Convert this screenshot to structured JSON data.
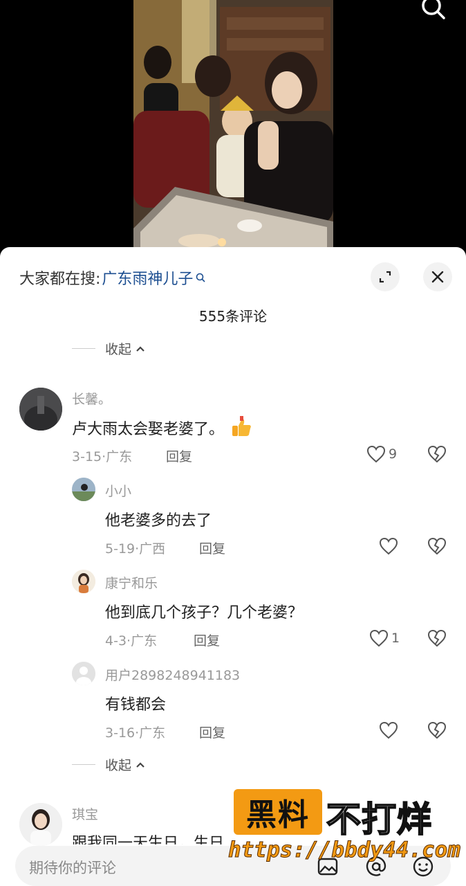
{
  "search": {
    "prefix": "大家都在搜:",
    "term": "广东雨神儿子"
  },
  "comments_count": "555条评论",
  "collapse_label": "收起",
  "top_comment": {
    "user": "长馨。",
    "text": "卢大雨太会娶老婆了。",
    "meta": "3-15·广东",
    "reply_label": "回复",
    "likes": "9"
  },
  "replies": [
    {
      "user": "小小",
      "text": "他老婆多的去了",
      "meta": "5-19·广西",
      "reply_label": "回复",
      "likes": ""
    },
    {
      "user": "康宁和乐",
      "text": "他到底几个孩子？几个老婆？",
      "meta": "4-3·广东",
      "reply_label": "回复",
      "likes": "1"
    },
    {
      "user": "用户2898248941183",
      "text": "有钱都会",
      "meta": "3-16·广东",
      "reply_label": "回复",
      "likes": ""
    }
  ],
  "next_comment": {
    "user": "琪宝",
    "text": "跟我同一天生日，生日"
  },
  "input": {
    "placeholder": "期待你的评论"
  },
  "watermark": {
    "badge": "黑料",
    "text": "不打烊",
    "url": "https://bbdy44.com"
  },
  "colors": {
    "link": "#1d4f91",
    "watermark_orange": "#f39a13"
  }
}
